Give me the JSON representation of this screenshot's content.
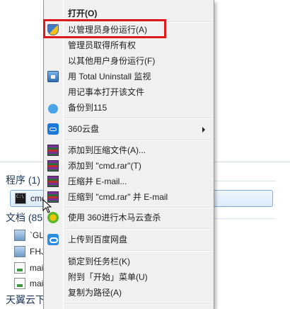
{
  "context_menu": {
    "items": [
      {
        "label": "打开(O)",
        "icon": null,
        "bold": true
      },
      {
        "label": "以管理员身份运行(A)",
        "icon": "uac-shield-icon",
        "highlighted": true
      },
      {
        "label": "管理员取得所有权",
        "icon": null
      },
      {
        "label": "以其他用户身份运行(F)",
        "icon": null
      },
      {
        "label": "用 Total Uninstall 监视",
        "icon": "total-uninstall-icon"
      },
      {
        "label": "用记事本打开该文件",
        "icon": null
      },
      {
        "label": "备份到115",
        "icon": "cloud-115-icon"
      },
      {
        "label": "360云盘",
        "icon": "360-cloud-icon",
        "submenu": true
      },
      {
        "label": "添加到压缩文件(A)...",
        "icon": "winrar-icon"
      },
      {
        "label": "添加到 \"cmd.rar\"(T)",
        "icon": "winrar-icon"
      },
      {
        "label": "压缩并 E-mail...",
        "icon": "winrar-icon"
      },
      {
        "label": "压缩到 \"cmd.rar\" 并 E-mail",
        "icon": "winrar-icon"
      },
      {
        "label": "使用 360进行木马云查杀",
        "icon": "360-trojan-scan-icon"
      },
      {
        "label": "上传到百度网盘",
        "icon": "baidu-netdisk-icon"
      },
      {
        "label": "锁定到任务栏(K)",
        "icon": null
      },
      {
        "label": "附到「开始」菜单(U)",
        "icon": null
      },
      {
        "label": "复制为路径(A)",
        "icon": null
      }
    ],
    "highlight_color": "#e01a1a"
  },
  "search_results": {
    "programs_heading": "程序 (1)",
    "programs": [
      {
        "name": "cmd",
        "icon": "cmd-icon"
      }
    ],
    "documents_heading": "文档 (85",
    "documents": [
      {
        "name": "`GLI",
        "icon": "image-file-icon"
      },
      {
        "name": "FHJ",
        "icon": "image-file-icon"
      },
      {
        "name": "mai",
        "icon": "text-file-icon"
      },
      {
        "name": "mai",
        "icon": "text-file-icon"
      }
    ],
    "third_heading": "天翼云下"
  }
}
